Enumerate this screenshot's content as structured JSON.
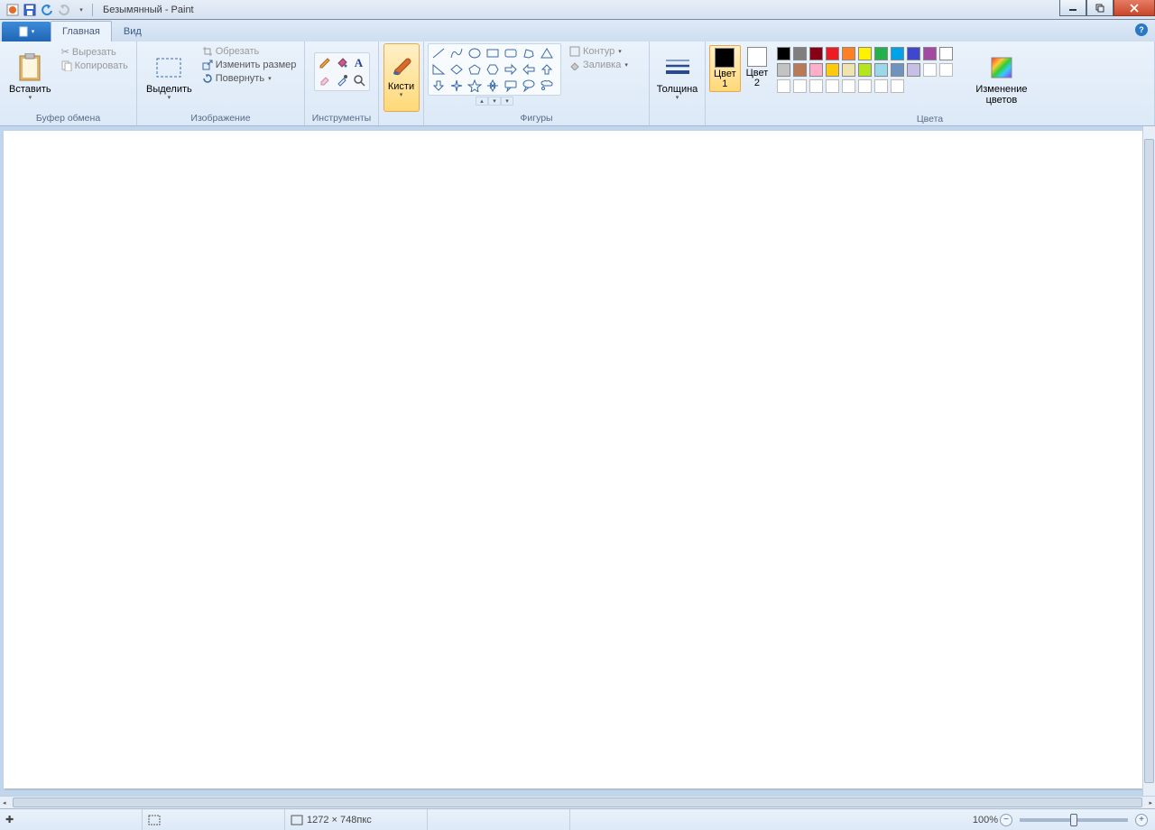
{
  "title": "Безымянный - Paint",
  "tabs": {
    "file": "▾",
    "home": "Главная",
    "view": "Вид"
  },
  "clipboard": {
    "paste": "Вставить",
    "cut": "Вырезать",
    "copy": "Копировать",
    "group": "Буфер обмена"
  },
  "image": {
    "select": "Выделить",
    "crop": "Обрезать",
    "resize": "Изменить размер",
    "rotate": "Повернуть",
    "group": "Изображение"
  },
  "tools": {
    "group": "Инструменты"
  },
  "brushes": {
    "label": "Кисти"
  },
  "shapes": {
    "outline": "Контур",
    "fill": "Заливка",
    "group": "Фигуры"
  },
  "size": {
    "label": "Толщина"
  },
  "colors": {
    "c1": "Цвет\n1",
    "c2": "Цвет\n2",
    "edit": "Изменение\nцветов",
    "group": "Цвета",
    "row1": [
      "#000000",
      "#7f7f7f",
      "#880015",
      "#ed1c24",
      "#ff7f27",
      "#fff200",
      "#22b14c",
      "#00a2e8",
      "#3f48cc",
      "#a349a4"
    ],
    "row2": [
      "#ffffff",
      "#c3c3c3",
      "#b97a57",
      "#ffaec9",
      "#ffc90e",
      "#efe4b0",
      "#b5e61d",
      "#99d9ea",
      "#7092be",
      "#c8bfe7"
    ],
    "c1_value": "#000000",
    "c2_value": "#ffffff"
  },
  "status": {
    "size": "1272 × 748пкс",
    "zoom": "100%"
  }
}
